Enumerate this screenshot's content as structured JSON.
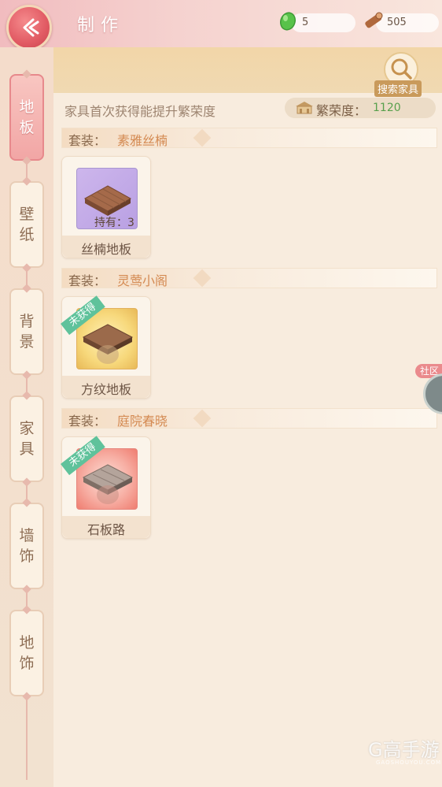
{
  "header": {
    "title": "制作",
    "jade_count": "5",
    "wood_count": "505"
  },
  "sidebar": {
    "items": [
      {
        "label_top": "地",
        "label_bottom": "板",
        "active": true
      },
      {
        "label_top": "壁",
        "label_bottom": "纸",
        "active": false
      },
      {
        "label_top": "背",
        "label_bottom": "景",
        "active": false
      },
      {
        "label_top": "家",
        "label_bottom": "具",
        "active": false
      },
      {
        "label_top": "墙",
        "label_bottom": "饰",
        "active": false
      },
      {
        "label_top": "地",
        "label_bottom": "饰",
        "active": false
      }
    ]
  },
  "main": {
    "search_label": "搜索家具",
    "hint": "家具首次获得能提升繁荣度",
    "prosperity_label": "繁荣度：",
    "prosperity_value": "1120",
    "sets": [
      {
        "label": "套装：",
        "name": "素雅丝楠",
        "items": [
          {
            "name": "丝楠地板",
            "owned": "持有：3",
            "obtained": true
          }
        ]
      },
      {
        "label": "套装：",
        "name": "灵莺小阁",
        "items": [
          {
            "name": "方纹地板",
            "ribbon": "未获得",
            "obtained": false
          }
        ]
      },
      {
        "label": "套装：",
        "name": "庭院春晓",
        "items": [
          {
            "name": "石板路",
            "ribbon": "未获得",
            "obtained": false
          }
        ]
      }
    ]
  },
  "community": {
    "label": "社区"
  },
  "watermark": {
    "text": "G高手游",
    "sub": "GAOSHOUYOU.COM"
  },
  "colors": {
    "accent_red": "#e15a63",
    "gold": "#c99a5b",
    "prosperity_green": "#58a04c",
    "set_name": "#d48a52",
    "ribbon_green": "#5fc29b"
  }
}
